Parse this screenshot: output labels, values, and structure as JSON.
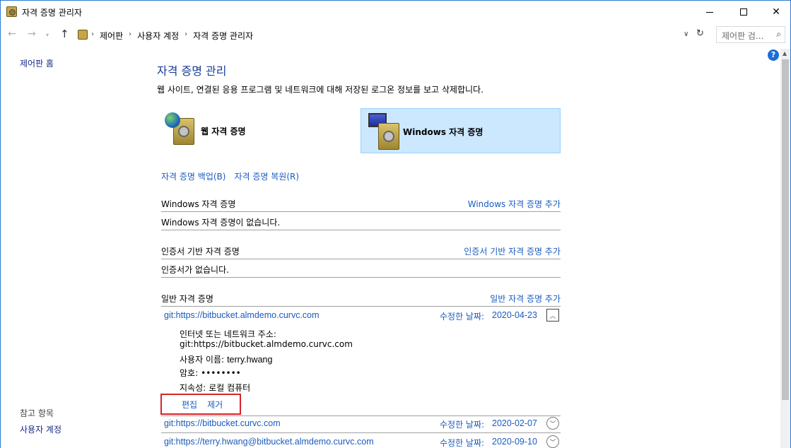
{
  "window": {
    "title": "자격 증명 관리자"
  },
  "address": {
    "crumbs": [
      "제어판",
      "사용자 계정",
      "자격 증명 관리자"
    ],
    "search_placeholder": "제어판 검..."
  },
  "left_pane": {
    "home": "제어판 홈",
    "see_also": "참고 항목",
    "user_accounts": "사용자 계정"
  },
  "main": {
    "title": "자격 증명 관리",
    "description": "웹 사이트, 연결된 응용 프로그램 및 네트워크에 대해 저장된 로그온 정보를 보고 삭제합니다.",
    "types": {
      "web": "웹 자격 증명",
      "windows": "Windows 자격 증명",
      "selected": "windows"
    },
    "backup": "자격 증명 백업(B)",
    "restore": "자격 증명 복원(R)",
    "sections": {
      "windows": {
        "title": "Windows 자격 증명",
        "add": "Windows 자격 증명 추가",
        "empty": "Windows 자격 증명이 없습니다."
      },
      "certificate": {
        "title": "인증서 기반 자격 증명",
        "add": "인증서 기반 자격 증명 추가",
        "empty": "인증서가 없습니다."
      },
      "generic": {
        "title": "일반 자격 증명",
        "add": "일반 자격 증명 추가"
      }
    },
    "date_label": "수정한 날짜:",
    "credentials": [
      {
        "name": "git:https://bitbucket.almdemo.curvc.com",
        "date": "2020-04-23",
        "expanded": true,
        "details": {
          "address_label": "인터넷 또는 네트워크 주소:",
          "address": "git:https://bitbucket.almdemo.curvc.com",
          "username_label": "사용자 이름:",
          "username": "terry.hwang",
          "password_label": "암호:",
          "password": "••••••••",
          "persistence_label": "지속성:",
          "persistence": "로컬 컴퓨터",
          "edit": "편집",
          "remove": "제거"
        }
      },
      {
        "name": "git:https://bitbucket.curvc.com",
        "date": "2020-02-07",
        "expanded": false
      },
      {
        "name": "git:https://terry.hwang@bitbucket.almdemo.curvc.com",
        "date": "2020-09-10",
        "expanded": false
      }
    ]
  }
}
